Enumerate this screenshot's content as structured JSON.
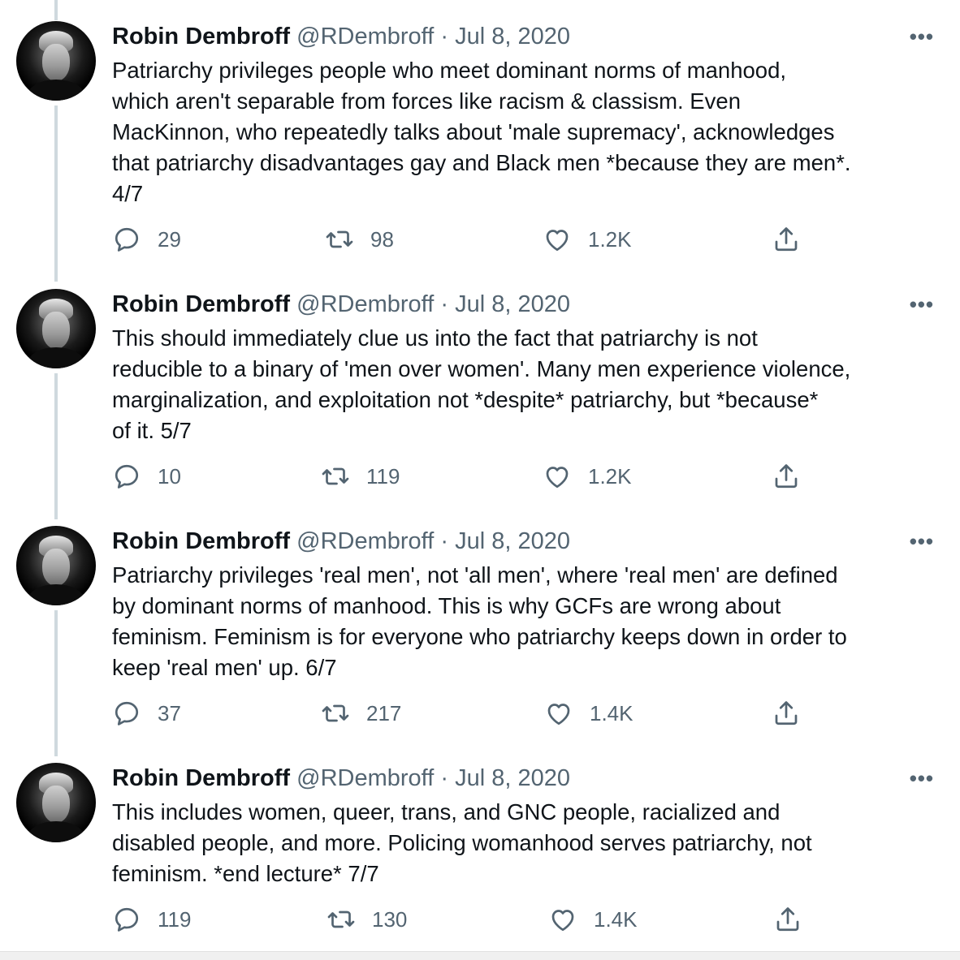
{
  "tweets": [
    {
      "name": "Robin Dembroff",
      "handle": "@RDembroff",
      "separator": "·",
      "date": "Jul 8, 2020",
      "more": "•••",
      "text": "Patriarchy privileges people who meet dominant norms of manhood,\nwhich aren't separable from forces like racism & classism. Even\nMacKinnon, who repeatedly talks about 'male supremacy', acknowledges\nthat patriarchy disadvantages gay and Black men *because they are men*.\n4/7",
      "replies": "29",
      "retweets": "98",
      "likes": "1.2K"
    },
    {
      "name": "Robin Dembroff",
      "handle": "@RDembroff",
      "separator": "·",
      "date": "Jul 8, 2020",
      "more": "•••",
      "text": "This should immediately clue us into the fact that patriarchy is not\nreducible to a binary of 'men over women'. Many men experience violence,\nmarginalization, and exploitation not *despite* patriarchy, but *because*\nof it. 5/7",
      "replies": "10",
      "retweets": "119",
      "likes": "1.2K"
    },
    {
      "name": "Robin Dembroff",
      "handle": "@RDembroff",
      "separator": "·",
      "date": "Jul 8, 2020",
      "more": "•••",
      "text": "Patriarchy privileges 'real men', not 'all men', where 'real men' are defined\nby dominant norms of manhood. This is why GCFs are wrong about\nfeminism. Feminism is for everyone who patriarchy keeps down in order to\nkeep 'real men' up. 6/7",
      "replies": "37",
      "retweets": "217",
      "likes": "1.4K"
    },
    {
      "name": "Robin Dembroff",
      "handle": "@RDembroff",
      "separator": "·",
      "date": "Jul 8, 2020",
      "more": "•••",
      "text": "This includes women, queer, trans, and GNC people, racialized and\ndisabled people, and more. Policing womanhood serves patriarchy, not\nfeminism. *end lecture* 7/7",
      "replies": "119",
      "retweets": "130",
      "likes": "1.4K"
    }
  ],
  "icons": {
    "reply": "reply-icon",
    "retweet": "retweet-icon",
    "like": "heart-icon",
    "share": "share-icon",
    "more": "more-icon"
  },
  "colors": {
    "text": "#0f1419",
    "muted": "#536471",
    "thread_line": "#cfd9de"
  }
}
